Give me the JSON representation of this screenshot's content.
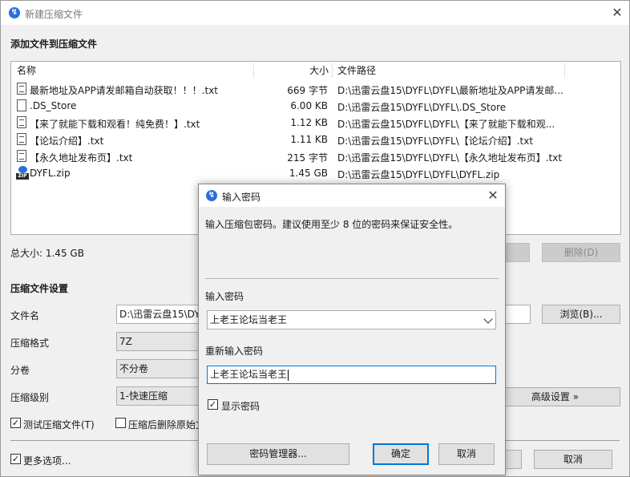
{
  "window": {
    "title": "新建压缩文件"
  },
  "add_section": {
    "title": "添加文件到压缩文件"
  },
  "file_list": {
    "columns": {
      "name": "名称",
      "size": "大小",
      "path": "文件路径"
    },
    "rows": [
      {
        "name": "最新地址及APP请发邮箱自动获取！！！.txt",
        "size": "669 字节",
        "path": "D:\\迅雷云盘15\\DYFL\\DYFL\\最新地址及APP请发邮...",
        "icon": "txt-file-icon"
      },
      {
        "name": ".DS_Store",
        "size": "6.00 KB",
        "path": "D:\\迅雷云盘15\\DYFL\\DYFL\\.DS_Store",
        "icon": "file-icon"
      },
      {
        "name": "【来了就能下载和观看！纯免费！】.txt",
        "size": "1.12 KB",
        "path": "D:\\迅雷云盘15\\DYFL\\DYFL\\【来了就能下载和观...",
        "icon": "txt-file-icon"
      },
      {
        "name": "【论坛介绍】.txt",
        "size": "1.11 KB",
        "path": "D:\\迅雷云盘15\\DYFL\\DYFL\\【论坛介绍】.txt",
        "icon": "txt-file-icon"
      },
      {
        "name": "【永久地址发布页】.txt",
        "size": "215 字节",
        "path": "D:\\迅雷云盘15\\DYFL\\DYFL\\【永久地址发布页】.txt",
        "icon": "txt-file-icon"
      },
      {
        "name": "DYFL.zip",
        "size": "1.45 GB",
        "path": "D:\\迅雷云盘15\\DYFL\\DYFL\\DYFL.zip",
        "icon": "zip-file-icon"
      }
    ]
  },
  "total_size": "总大小: 1.45 GB",
  "delete_button": "删除(D)",
  "settings": {
    "title": "压缩文件设置",
    "filename_label": "文件名",
    "filename_value": "D:\\迅雷云盘15\\DY",
    "browse_button": "浏览(B)...",
    "format_label": "压缩格式",
    "format_value": "7Z",
    "split_label": "分卷",
    "split_value": "不分卷",
    "level_label": "压缩级别",
    "level_value": "1-快速压缩",
    "advanced_button": "高级设置 »",
    "test_label": "测试压缩文件(T)",
    "test_checked": true,
    "delete_after_label": "压缩后删除原始文",
    "delete_after_checked": false,
    "more_options_label": "更多选项...",
    "more_options_checked": true,
    "cancel_button": "取消"
  },
  "dialog": {
    "title": "输入密码",
    "description": "输入压缩包密码。建议使用至少 8 位的密码来保证安全性。",
    "password_label": "输入密码",
    "password_value": "上老王论坛当老王",
    "reenter_label": "重新输入密码",
    "reenter_value": "上老王论坛当老王",
    "show_password_label": "显示密码",
    "show_password_checked": true,
    "manager_button": "密码管理器...",
    "ok_button": "确定",
    "cancel_button": "取消"
  },
  "colors": {
    "accent": "#0078d7",
    "app_icon": "#2a6fdb"
  }
}
